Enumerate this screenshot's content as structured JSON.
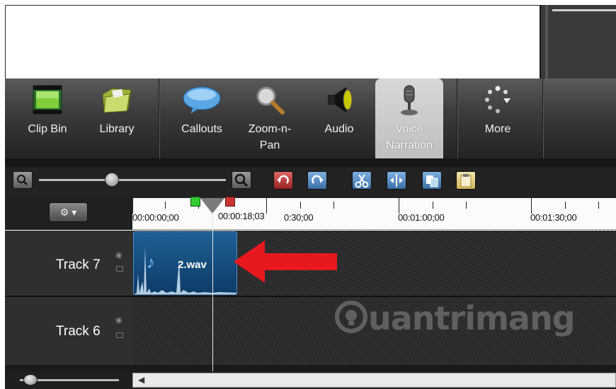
{
  "toolbar": {
    "clip_bin": "Clip Bin",
    "library": "Library",
    "callouts": "Callouts",
    "zoom_n_pan_1": "Zoom-n-",
    "zoom_n_pan_2": "Pan",
    "audio": "Audio",
    "voice_narration_1": "Voice",
    "voice_narration_2": "Narration",
    "more": "More"
  },
  "ruler": {
    "t0": "00:00:00;00",
    "playhead_time": "00:00:18;03",
    "t30": "0:30;00",
    "t60": "00:01:00;00",
    "t90": "00:01:30;00"
  },
  "tracks": [
    {
      "name": "Track 7"
    },
    {
      "name": "Track 6"
    }
  ],
  "clip": {
    "name": "2.wav"
  },
  "watermark": "uantrimang",
  "colors": {
    "clip": "#1f5f96",
    "arrow": "#e8191e",
    "active_tab": "#d0d0d0"
  }
}
